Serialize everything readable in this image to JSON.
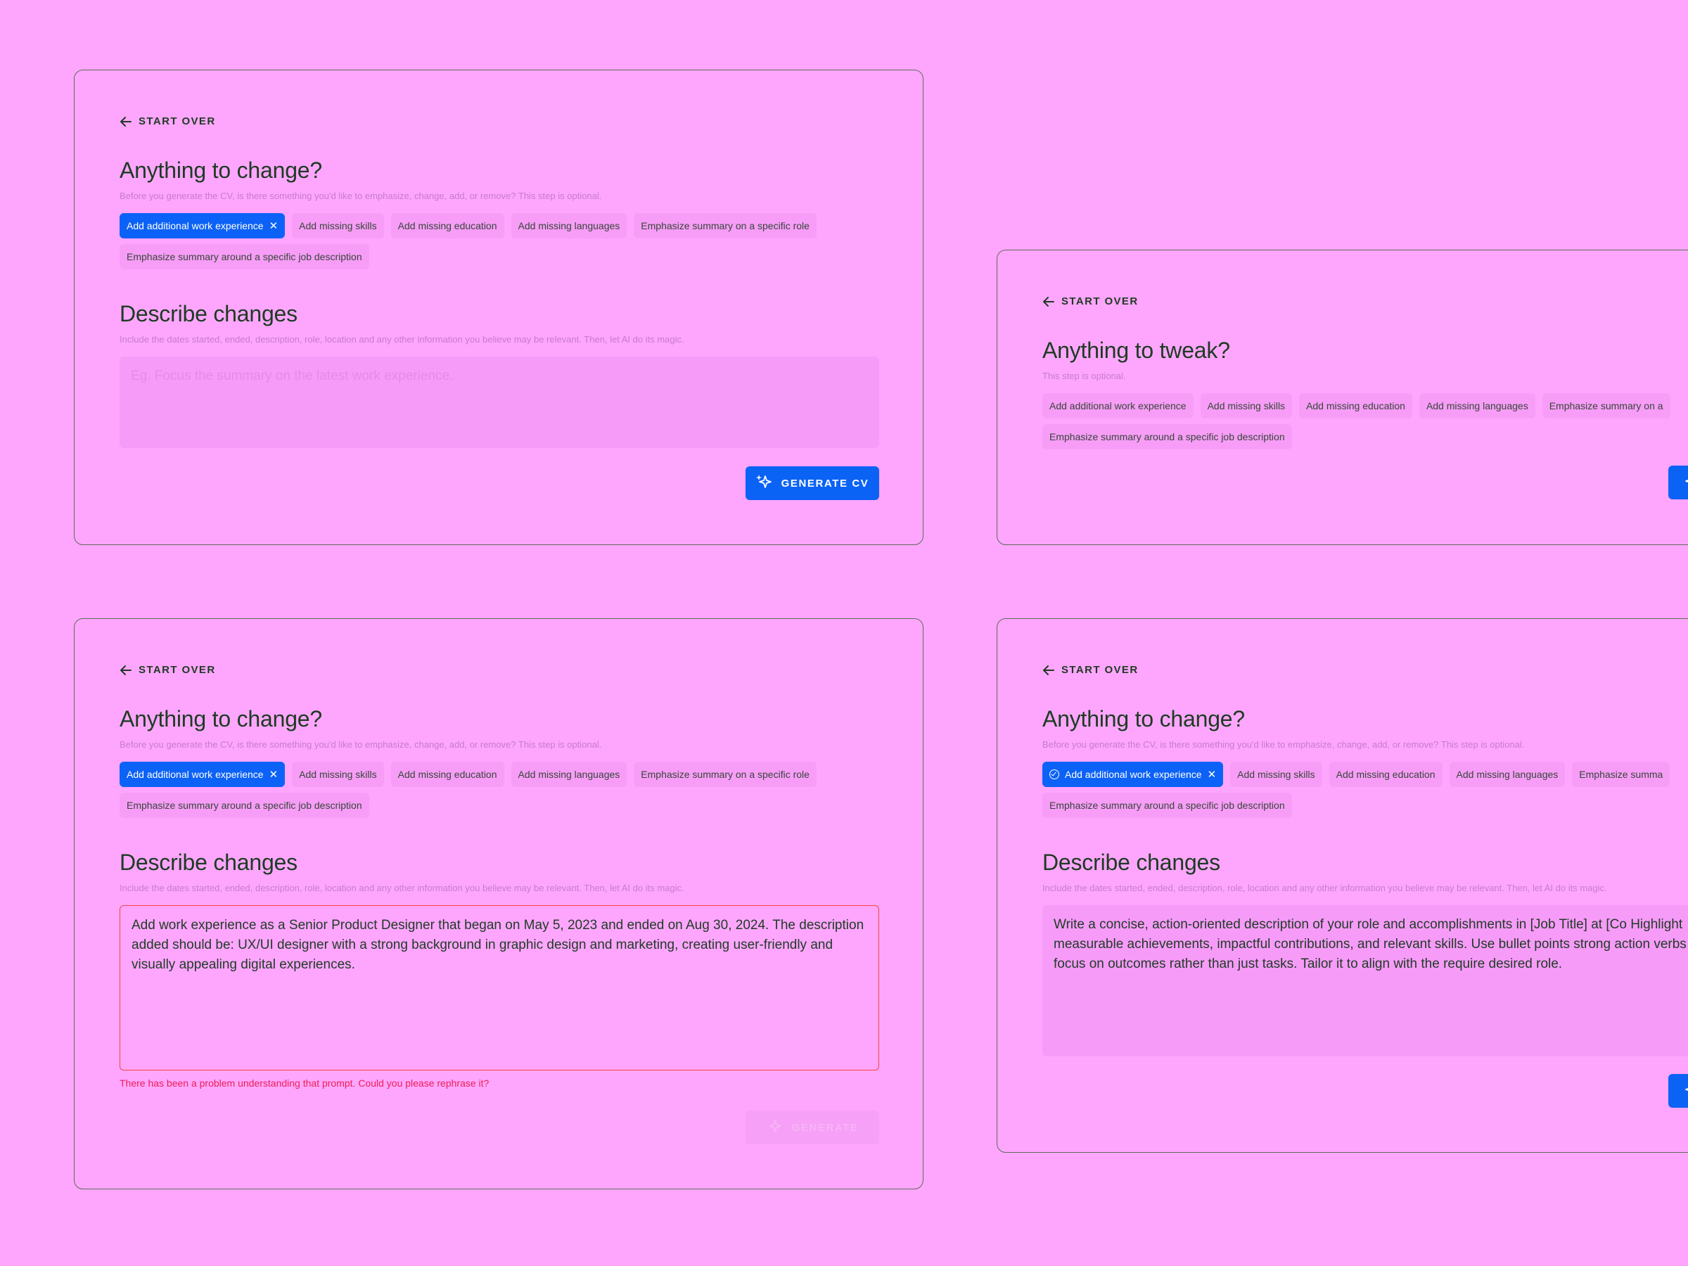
{
  "common": {
    "start_over": "START OVER",
    "generate_label": "GENERATE CV",
    "generate_partial": "GENERATE"
  },
  "colors": {
    "background": "#fea6fe",
    "accent": "#0c62f6",
    "heading": "#1d3b22",
    "error": "#ea1f55"
  },
  "icons": {
    "back": "arrow-left-icon",
    "generate": "sparkles-icon",
    "remove": "close-icon",
    "selected": "check-circle-icon"
  },
  "card_a": {
    "title": "Anything to change?",
    "subtitle": "Before you generate the CV, is there something you'd like to emphasize, change, add, or remove? This step is optional.",
    "chips": [
      "Add additional work experience",
      "Add missing skills",
      "Add missing education",
      "Add missing languages",
      "Emphasize summary on a specific role",
      "Emphasize summary around a specific job description"
    ],
    "describe_title": "Describe changes",
    "describe_subtitle": "Include the dates started, ended, description, role, location and any other information you believe may be relevant. Then, let AI do its magic.",
    "placeholder": "Eg. Focus the summary on the latest work experience."
  },
  "card_b": {
    "title": "Anything to tweak?",
    "subtitle": "This step is optional.",
    "chips": [
      "Add additional work experience",
      "Add missing skills",
      "Add missing education",
      "Add missing languages",
      "Emphasize summary on a",
      "Emphasize summary around a specific job description"
    ]
  },
  "card_c": {
    "title": "Anything to change?",
    "subtitle": "Before you generate the CV, is there something you'd like to emphasize, change, add, or remove? This step is optional.",
    "chips": [
      "Add additional work experience",
      "Add missing skills",
      "Add missing education",
      "Add missing languages",
      "Emphasize summary on a specific role",
      "Emphasize summary around a specific job description"
    ],
    "describe_title": "Describe changes",
    "describe_subtitle": "Include the dates started, ended, description, role, location and any other information you believe may be relevant. Then, let AI do its magic.",
    "value": "Add work experience as a Senior Product Designer that began on May 5, 2023 and ended on Aug 30, 2024. The description added should be: UX/UI designer with a strong background in graphic design and marketing, creating user-friendly and visually appealing digital experiences.",
    "error": "There has been a problem understanding that prompt. Could you please rephrase it?"
  },
  "card_d": {
    "title": "Anything to change?",
    "subtitle": "Before you generate the CV, is there something you'd like to emphasize, change, add, or remove? This step is optional.",
    "chips": [
      "Add additional work experience",
      "Add missing skills",
      "Add missing education",
      "Add missing languages",
      "Emphasize summa",
      "Emphasize summary around a specific job description"
    ],
    "describe_title": "Describe changes",
    "describe_subtitle": "Include the dates started, ended, description, role, location and any other information you believe may be relevant. Then, let AI do its magic.",
    "value": "Write a concise, action-oriented description of your role and accomplishments in [Job Title] at [Co Highlight measurable achievements, impactful contributions, and relevant skills. Use bullet points strong action verbs and focus on outcomes rather than just tasks. Tailor it to align with the require desired role."
  }
}
